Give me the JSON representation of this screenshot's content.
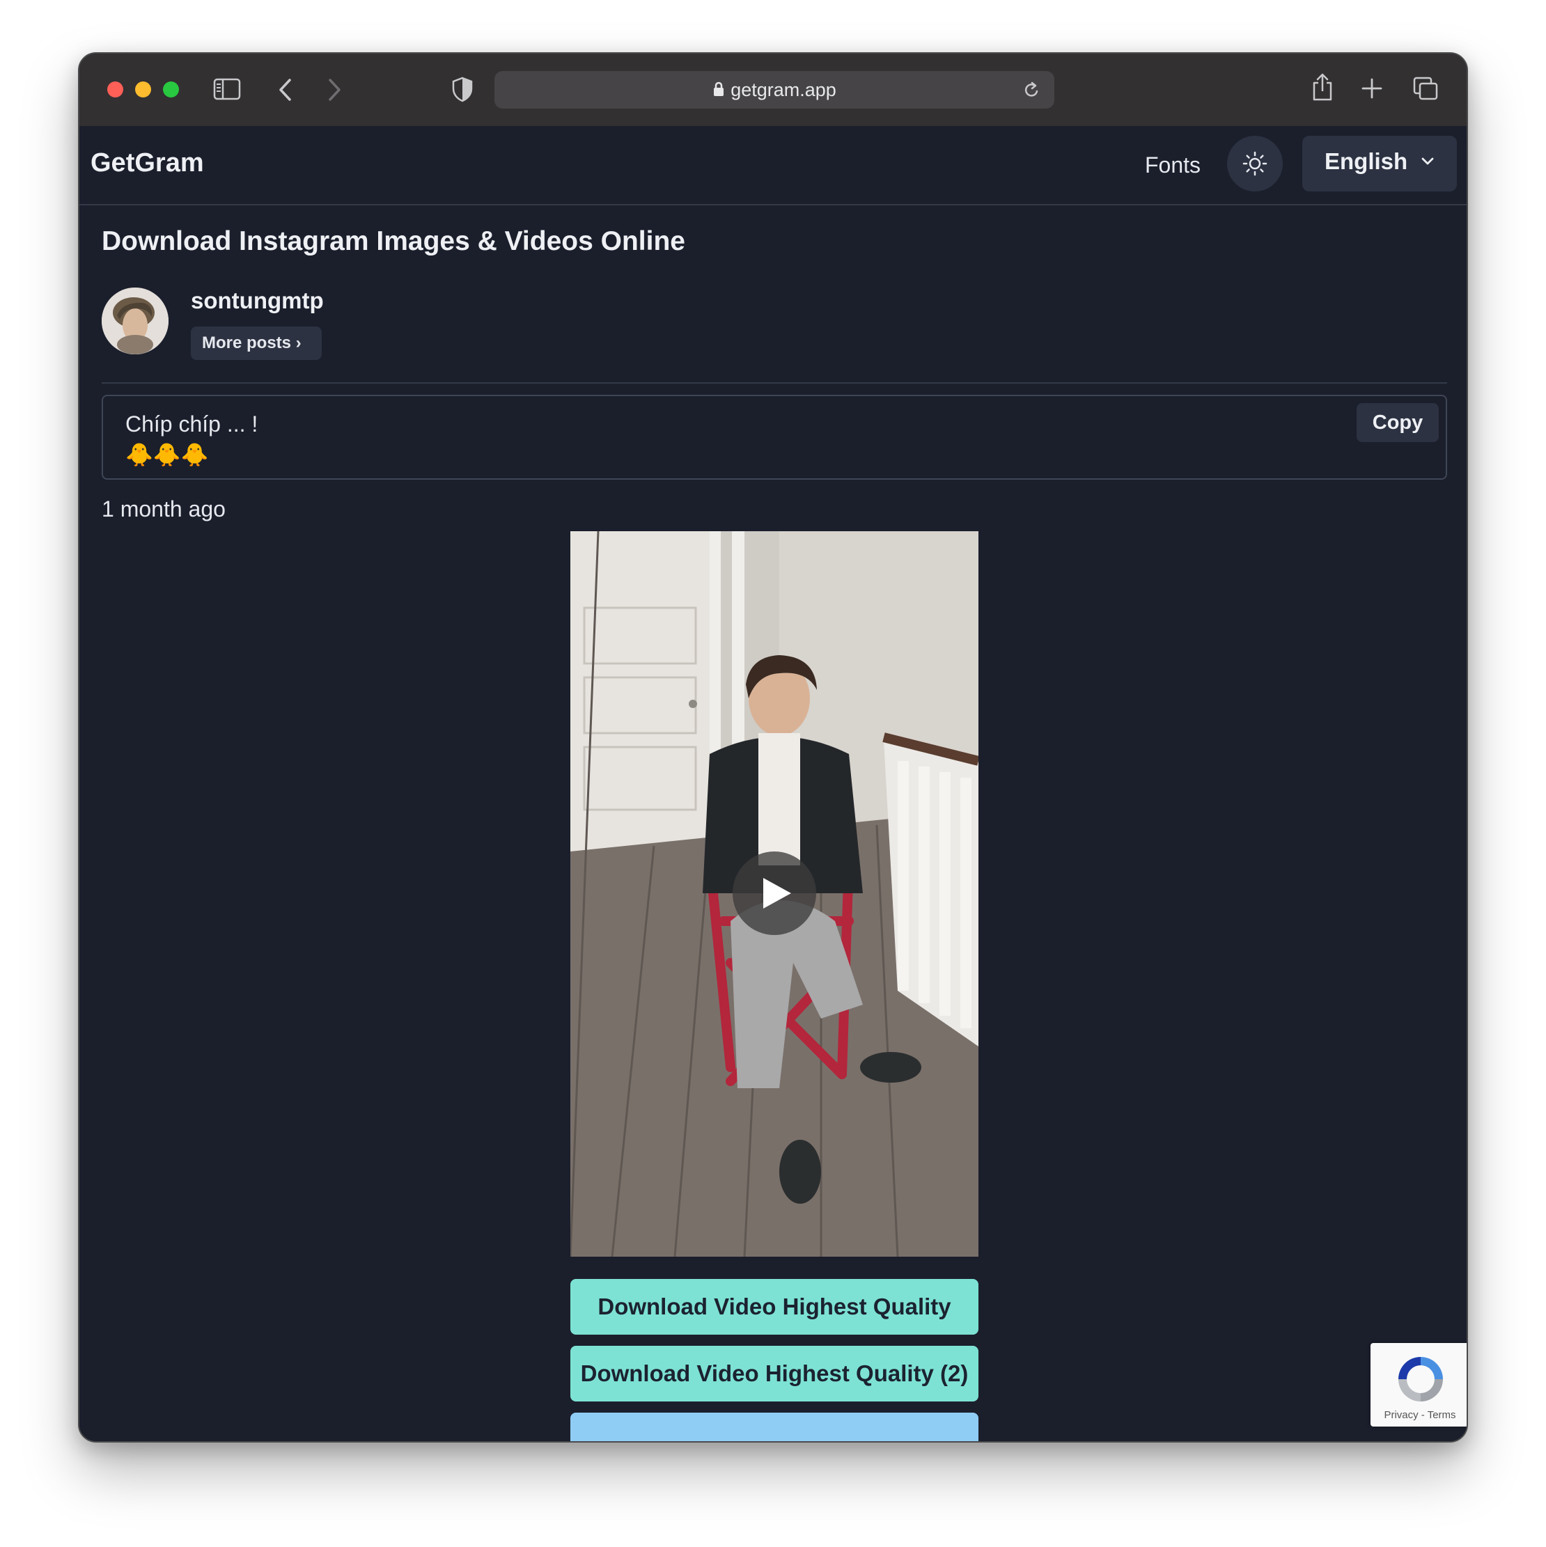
{
  "browser": {
    "url": "getgram.app"
  },
  "nav": {
    "brand": "GetGram",
    "fonts_label": "Fonts",
    "language": "English"
  },
  "main": {
    "heading": "Download Instagram Images & Videos Online",
    "username": "sontungmtp",
    "more_posts_label": "More posts ›",
    "caption": "Chíp chíp ... !\n🐥🐥🐥",
    "copy_label": "Copy",
    "timestamp": "1 month ago",
    "download_buttons": [
      "Download Video Highest Quality",
      "Download Video Highest Quality (2)"
    ]
  },
  "recaptcha": {
    "privacy": "Privacy",
    "separator": " - ",
    "terms": "Terms"
  },
  "colors": {
    "page_bg": "#1b1f2c",
    "accent_button": "#7de2d4",
    "secondary_button": "#90cdf4"
  }
}
